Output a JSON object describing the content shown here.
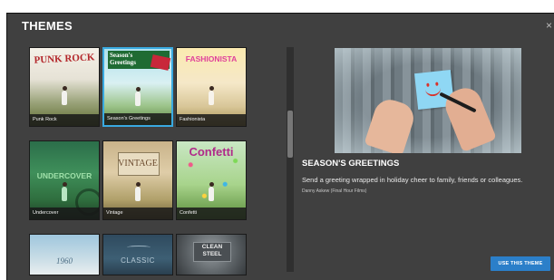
{
  "dialog": {
    "title": "THEMES",
    "close_glyph": "×"
  },
  "themes": [
    {
      "label": "Punk Rock",
      "display_title": "PUNK ROCK",
      "selected": false
    },
    {
      "label": "Season's Greetings",
      "display_title": "Season's Greetings",
      "selected": true
    },
    {
      "label": "Fashionista",
      "display_title": "FASHIONISTA",
      "selected": false
    },
    {
      "label": "Undercover",
      "display_title": "UNDERCOVER",
      "selected": false
    },
    {
      "label": "Vintage",
      "display_title": "VINTAGE",
      "selected": false
    },
    {
      "label": "Confetti",
      "display_title": "Confetti",
      "selected": false
    },
    {
      "label": "",
      "display_title": "1960",
      "selected": false
    },
    {
      "label": "",
      "display_title": "CLASSIC",
      "selected": false
    },
    {
      "label": "",
      "display_title": "CLEAN STEEL",
      "selected": false
    }
  ],
  "detail": {
    "title": "SEASON'S GREETINGS",
    "description": "Send a greeting wrapped in holiday cheer to family, friends or colleagues.",
    "credit": "Danny Askew (Final Hour Films)"
  },
  "actions": {
    "use_theme_label": "USE THIS THEME"
  },
  "colors": {
    "accent": "#2b7fc9",
    "selected_border": "#39a9e0",
    "dialog_bg": "#404040"
  }
}
